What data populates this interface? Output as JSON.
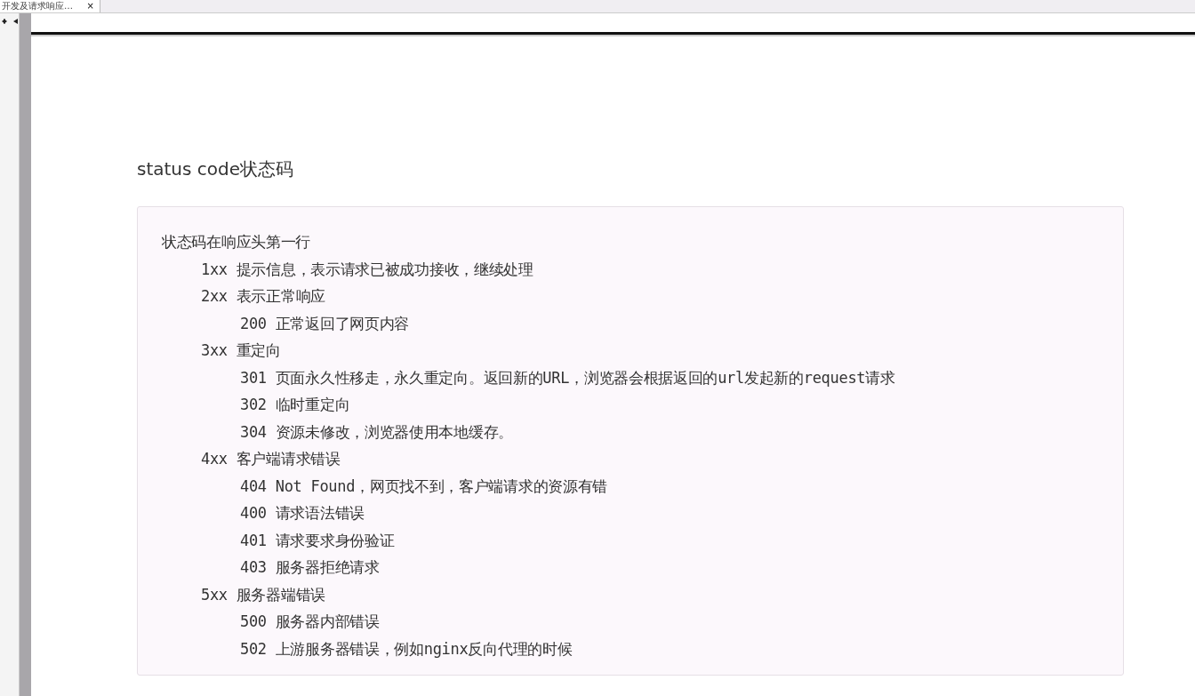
{
  "tab": {
    "title": "开发及请求响应…",
    "close": "×"
  },
  "heading": "status code状态码",
  "code_block": {
    "lines": [
      {
        "text": "状态码在响应头第一行",
        "children": [
          {
            "text": "1xx 提示信息，表示请求已被成功接收，继续处理"
          },
          {
            "text": "2xx 表示正常响应",
            "children": [
              {
                "text": "200 正常返回了网页内容"
              }
            ]
          },
          {
            "text": "3xx 重定向",
            "children": [
              {
                "text": "301 页面永久性移走，永久重定向。返回新的URL，浏览器会根据返回的url发起新的request请求"
              },
              {
                "text": "302 临时重定向"
              },
              {
                "text": "304 资源未修改，浏览器使用本地缓存。"
              }
            ]
          },
          {
            "text": "4xx 客户端请求错误",
            "children": [
              {
                "text": "404 Not Found，网页找不到，客户端请求的资源有错"
              },
              {
                "text": "400 请求语法错误"
              },
              {
                "text": "401 请求要求身份验证"
              },
              {
                "text": "403 服务器拒绝请求"
              }
            ]
          },
          {
            "text": "5xx 服务器端错误",
            "children": [
              {
                "text": "500 服务器内部错误"
              },
              {
                "text": "502 上游服务器错误，例如nginx反向代理的时候"
              }
            ]
          }
        ]
      }
    ]
  }
}
